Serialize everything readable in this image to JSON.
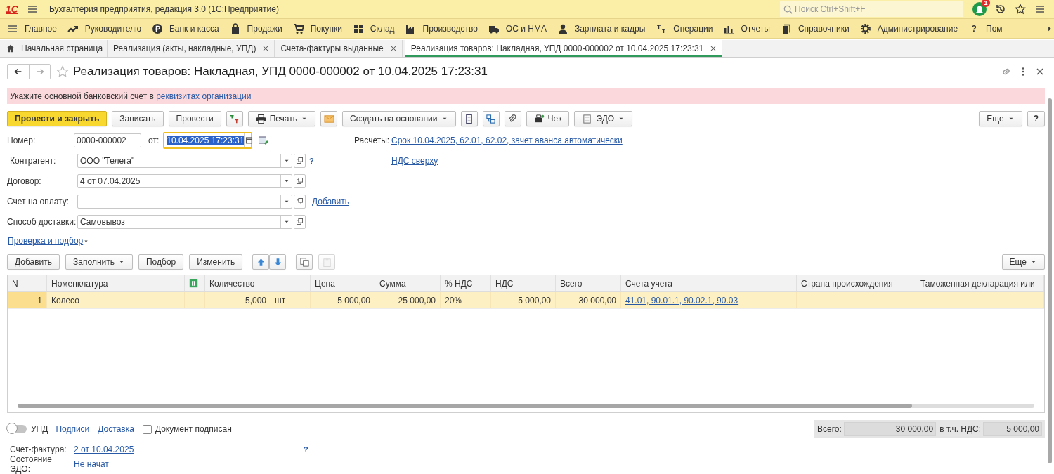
{
  "app_bar": {
    "logo": "1С",
    "title": "Бухгалтерия предприятия, редакция 3.0  (1С:Предприятие)",
    "search": {
      "placeholder": "Поиск Ctrl+Shift+F"
    },
    "notifications": "1"
  },
  "sections": [
    {
      "label": "Главное"
    },
    {
      "label": "Руководителю"
    },
    {
      "label": "Банк и касса"
    },
    {
      "label": "Продажи"
    },
    {
      "label": "Покупки"
    },
    {
      "label": "Склад"
    },
    {
      "label": "Производство"
    },
    {
      "label": "ОС и НМА"
    },
    {
      "label": "Зарплата и кадры"
    },
    {
      "label": "Операции"
    },
    {
      "label": "Отчеты"
    },
    {
      "label": "Справочники"
    },
    {
      "label": "Администрирование"
    },
    {
      "label": "Пом",
      "glyph": "?"
    }
  ],
  "tabs": [
    {
      "label": "Начальная страница",
      "selected": false,
      "closable": false
    },
    {
      "label": "Реализация (акты, накладные, УПД)",
      "selected": false,
      "closable": true
    },
    {
      "label": "Счета-фактуры выданные",
      "selected": false,
      "closable": true
    },
    {
      "label": "Реализация товаров: Накладная, УПД 0000-000002 от 10.04.2025 17:23:31",
      "selected": true,
      "closable": true
    }
  ],
  "document": {
    "title": "Реализация товаров: Накладная, УПД 0000-000002 от 10.04.2025 17:23:31",
    "favorite": false
  },
  "warning": {
    "text": "Укажите основной банковский счет в ",
    "link": "реквизитах организации"
  },
  "toolbar": [
    {
      "kind": "primary",
      "label": "Провести и закрыть"
    },
    {
      "kind": "button",
      "label": "Записать"
    },
    {
      "kind": "button",
      "label": "Провести"
    },
    {
      "kind": "icon"
    },
    {
      "kind": "button",
      "label": "Печать",
      "caret": true
    },
    {
      "kind": "icon"
    },
    {
      "kind": "button",
      "label": "Создать на основании",
      "caret": true
    },
    {
      "kind": "icon"
    },
    {
      "kind": "icon"
    },
    {
      "kind": "icon"
    },
    {
      "kind": "button",
      "label": "Чек"
    },
    {
      "kind": "button",
      "label": "ЭДО",
      "caret": true
    }
  ],
  "toolbar_right": [
    {
      "kind": "button",
      "label": "Еще",
      "caret": true
    },
    {
      "kind": "button",
      "label": "?"
    }
  ],
  "form": {
    "number": {
      "label": "Номер:",
      "value": "0000-000002"
    },
    "date": {
      "label": "от:",
      "value": "10.04.2025 17:23:31",
      "focused": true
    },
    "settlements": {
      "label": "Расчеты:",
      "link": "Срок 10.04.2025, 62.01, 62.02, зачет аванса автоматически"
    },
    "vat_link": "НДС сверху",
    "fields": [
      {
        "label": "Контрагент:",
        "value": "ООО \"Телега\"",
        "help": "?"
      },
      {
        "label": "Договор:",
        "value": "4 от 07.04.2025"
      },
      {
        "label": "Счет на оплату:",
        "link": "Добавить"
      },
      {
        "label": "Способ доставки:",
        "value": "Самовывоз"
      }
    ],
    "check_link": "Проверка и подбор"
  },
  "table_toolbar": [
    {
      "kind": "button",
      "label": "Добавить"
    },
    {
      "kind": "button",
      "label": "Заполнить",
      "caret": true
    },
    {
      "kind": "button",
      "label": "Подбор"
    },
    {
      "kind": "button",
      "label": "Изменить"
    },
    {
      "kind": "icon",
      "disabled": false
    },
    {
      "kind": "icon",
      "disabled": false
    },
    {
      "kind": "icon",
      "disabled": false
    },
    {
      "kind": "icon",
      "disabled": true
    }
  ],
  "table_more": {
    "label": "Еще",
    "caret": true
  },
  "table": {
    "columns": [
      {
        "label": "N"
      },
      {
        "label": "Номенклатура"
      },
      {
        "kind": "icon"
      },
      {
        "label": "Количество"
      },
      {
        "label": "Цена"
      },
      {
        "label": "Сумма"
      },
      {
        "label": "% НДС"
      },
      {
        "label": "НДС"
      },
      {
        "label": "Всего"
      },
      {
        "label": "Счета учета"
      },
      {
        "label": "Страна происхождения"
      },
      {
        "label": "Таможенная декларация или"
      }
    ],
    "rows": [
      {
        "selected": true,
        "n": "1",
        "item": "Колесо",
        "quantity": "5,000",
        "unit": "шт",
        "price": "5 000,00",
        "sum": "25 000,00",
        "vat_rate": "20%",
        "vat": "5 000,00",
        "total": "30 000,00",
        "accounts": "41.01, 90.01.1, 90.02.1, 90.03"
      }
    ]
  },
  "footer": {
    "upd": {
      "label": "УПД",
      "on": false
    },
    "links": [
      "Подписи",
      "Доставка"
    ],
    "signed": {
      "label": "Документ подписан",
      "checked": false
    },
    "totals": [
      {
        "label": "Всего:",
        "value": "30 000,00"
      },
      {
        "label": "в т.ч. НДС:",
        "value": "5 000,00"
      }
    ],
    "invoice": {
      "label": "Счет-фактура:",
      "link": "2 от 10.04.2025",
      "help": "?"
    },
    "edo": {
      "label": "Состояние ЭДО:",
      "link": "Не начат"
    }
  }
}
